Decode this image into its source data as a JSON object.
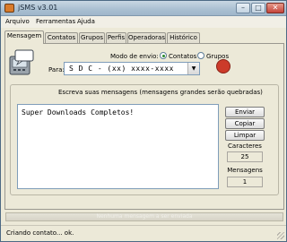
{
  "window": {
    "title": "jSMS v3.01",
    "controls": {
      "minimize": "–",
      "maximize": "□",
      "close": "✕"
    }
  },
  "menu": [
    "Arquivo",
    "Ferramentas",
    "Ajuda"
  ],
  "tabs": [
    {
      "label": "Mensagem",
      "active": true
    },
    {
      "label": "Contatos",
      "active": false
    },
    {
      "label": "Grupos",
      "active": false
    },
    {
      "label": "Perfis",
      "active": false
    },
    {
      "label": "Operadoras",
      "active": false
    },
    {
      "label": "Histórico",
      "active": false
    }
  ],
  "send_mode": {
    "label": "Modo de envio:",
    "options": [
      {
        "label": "Contatos",
        "checked": true
      },
      {
        "label": "Grupos",
        "checked": false
      }
    ]
  },
  "recipient": {
    "label": "Para:",
    "value": "S D C - (xx) xxxx-xxxx",
    "dropdown_icon": "▼"
  },
  "search_icon": {
    "name": "search-icon",
    "glyph": ""
  },
  "message": {
    "instruction": "Escreva suas mensagens (mensagens grandes serão quebradas)",
    "text": "Super Downloads Completos!"
  },
  "buttons": {
    "send": "Enviar",
    "copy": "Copiar",
    "clear": "Limpar"
  },
  "counters": {
    "chars_label": "Caracteres",
    "chars_value": "25",
    "msgs_label": "Mensagens",
    "msgs_value": "1"
  },
  "progress": {
    "text": "Nenhuma mensagem a ser enviada",
    "fraction": 0
  },
  "status": {
    "text": "Criando contato... ok."
  },
  "colors": {
    "accent_icon": "#cc3b2a",
    "window_bg": "#ece9d8"
  }
}
